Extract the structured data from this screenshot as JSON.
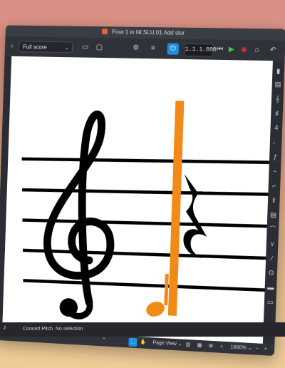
{
  "window": {
    "title": "Flow 1 in NI.SLU.01 Add slur"
  },
  "toolbar": {
    "layout_select": "Full score",
    "timecode": "1.1.1.000",
    "power_icon": "power-icon",
    "play_icon": "play-icon",
    "record_icon": "record-icon"
  },
  "bottombar": {
    "view_mode": "Page View",
    "zoom": "1600%"
  },
  "statusbar": {
    "pitch_mode": "Concert Pitch",
    "selection": "No selection"
  },
  "colors": {
    "accent": "#1e8fe0",
    "selection": "#f28a17",
    "notation": "#000000"
  }
}
